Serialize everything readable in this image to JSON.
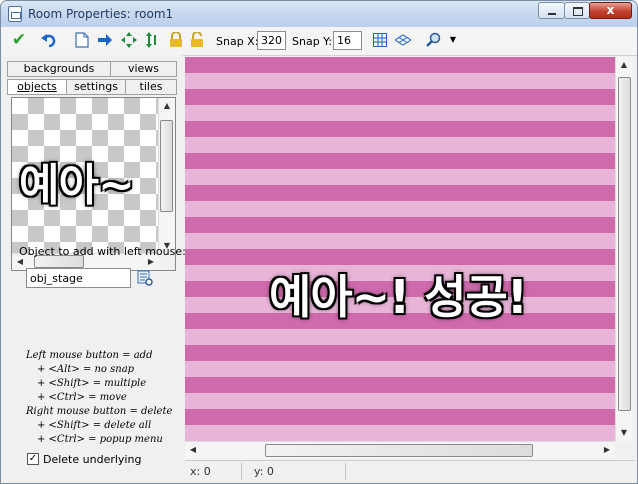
{
  "window": {
    "title": "Room Properties: room1",
    "close_label": "x"
  },
  "toolbar": {
    "snap_x_label": "Snap X:",
    "snap_x_value": "320",
    "snap_y_label": "Snap Y:",
    "snap_y_value": "16"
  },
  "tabs": {
    "row1": [
      "backgrounds",
      "views"
    ],
    "row2": [
      "objects",
      "settings",
      "tiles"
    ],
    "selected": "objects"
  },
  "objects_panel": {
    "caption": "Object to add with left mouse:",
    "object_value": "obj_stage",
    "help_lines": [
      "Left mouse button = add",
      "+ <Alt> = no snap",
      "+ <Shift> = multiple",
      "+ <Ctrl> = move",
      "Right mouse button = delete",
      "+ <Shift> = delete all",
      "+ <Ctrl> = popup menu"
    ],
    "delete_underlying_label": "Delete underlying",
    "delete_underlying_checked": true
  },
  "overlays": {
    "preview_text": "예아~",
    "room_text": "예아~! 성공!"
  },
  "status": {
    "x": "x: 0",
    "y": "y: 0"
  },
  "colors": {
    "stripe_dark": "#cf6aad",
    "stripe_light": "#e8b4d8",
    "accent_check": "#2e9e2e",
    "accent_blue": "#1a64c8"
  }
}
